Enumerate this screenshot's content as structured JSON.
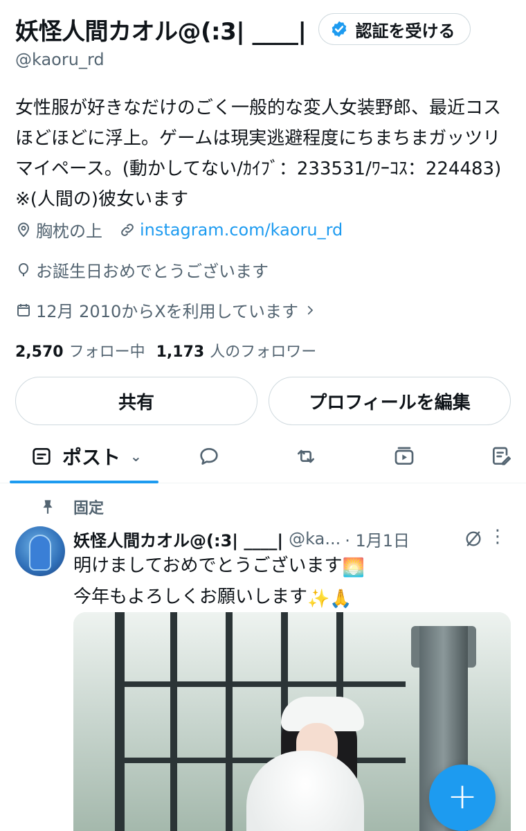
{
  "profile": {
    "display_name": "妖怪人間カオル@(:3| ____|",
    "handle": "@kaoru_rd",
    "verify_button": "認証を受ける",
    "bio": "女性服が好きなだけのごく一般的な変人女装野郎、最近コス\nほどほどに浮上。ゲームは現実逃避程度にちまちまガッツリ\nマイペース。(動かしてない/ｶｲﾌﾞ：233531/ﾜｰｺｽ：224483)\n※(人間の)彼女います",
    "location": "胸枕の上",
    "website": "instagram.com/kaoru_rd",
    "birthday": "お誕生日おめでとうございます",
    "joined": "12月 2010からXを利用しています",
    "following_count": "2,570",
    "following_label": "フォロー中",
    "followers_count": "1,173",
    "followers_label": "人のフォロワー"
  },
  "actions": {
    "share": "共有",
    "edit_profile": "プロフィールを編集"
  },
  "tabs": {
    "posts_label": "ポスト",
    "icons": [
      "posts-icon",
      "replies-icon",
      "reposts-icon",
      "media-icon",
      "articles-icon"
    ]
  },
  "pinned_post": {
    "pinned_label": "固定",
    "author_name": "妖怪人間カオル@(:3| ____|",
    "author_handle": "@ka...",
    "time": "· 1月1日",
    "more": "⋮",
    "text_line1": "明けましておめでとうございます",
    "text_line2": "今年もよろしくお願いします",
    "emoji_sunrise": "🌅",
    "emoji_sparkles": "✨",
    "emoji_pray": "🙏"
  },
  "fab_label": "+",
  "colors": {
    "accent": "#1d9bf0",
    "text_primary": "#0f1419",
    "text_secondary": "#536471",
    "border": "#cfd9de"
  }
}
